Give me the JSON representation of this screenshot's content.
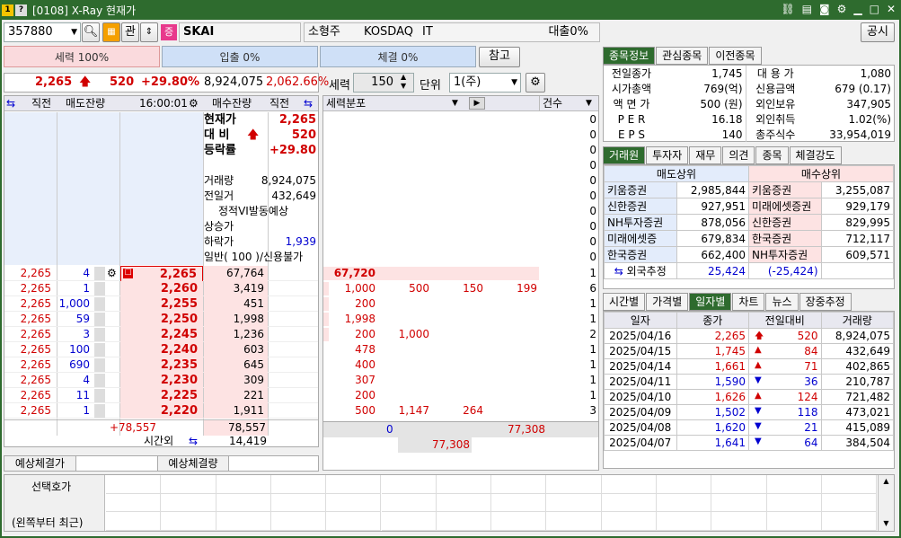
{
  "window": {
    "title": "[0108] X-Ray 현재가",
    "badge1": "1",
    "badge2": "?"
  },
  "toolbar": {
    "code": "357880",
    "btn_g": "관",
    "btn_jeung": "증",
    "name": "SKAI",
    "market_type": "소형주",
    "market": "KOSDAQ",
    "sector": "IT",
    "loan": "대출0%",
    "notice_btn": "공시"
  },
  "power": {
    "seryeok": "세력 100%",
    "ipchul": "입출 0%",
    "chegyeol": "체결 0%",
    "ref_btn": "참고"
  },
  "price_bar": {
    "price": "2,265",
    "change": "520",
    "rate": "+29.80%",
    "volume": "8,924,075",
    "vol_rate": "2,062.66%",
    "seryeok_label": "세력",
    "seryeok_val": "150",
    "unit_label": "단위",
    "unit_val": "1(주)"
  },
  "ob_header": {
    "h1": "직전",
    "h2": "매도잔량",
    "time": "16:00:01",
    "h4": "매수잔량",
    "h5": "직전"
  },
  "info": {
    "cur_label": "현재가",
    "cur_val": "2,265",
    "diff_label": "대 비",
    "diff_val": "520",
    "rate_label": "등락률",
    "rate_val": "+29.80",
    "vol_label": "거래량",
    "vol_val": "8,924,075",
    "prev_label": "전일거",
    "prev_val": "432,649",
    "vi": "정적VI발동예상",
    "upper": "상승가",
    "lower_label": "하락가",
    "lower_val": "1,939",
    "general": "일반( 100 )/신용불가"
  },
  "bids": [
    {
      "prev": "2,265",
      "qty": "4",
      "price": "2,265",
      "remain": "67,764"
    },
    {
      "prev": "2,265",
      "qty": "1",
      "price": "2,260",
      "remain": "3,419"
    },
    {
      "prev": "2,265",
      "qty": "1,000",
      "price": "2,255",
      "remain": "451"
    },
    {
      "prev": "2,265",
      "qty": "59",
      "price": "2,250",
      "remain": "1,998"
    },
    {
      "prev": "2,265",
      "qty": "3",
      "price": "2,245",
      "remain": "1,236"
    },
    {
      "prev": "2,265",
      "qty": "100",
      "price": "2,240",
      "remain": "603"
    },
    {
      "prev": "2,265",
      "qty": "690",
      "price": "2,235",
      "remain": "645"
    },
    {
      "prev": "2,265",
      "qty": "4",
      "price": "2,230",
      "remain": "309"
    },
    {
      "prev": "2,265",
      "qty": "11",
      "price": "2,225",
      "remain": "221"
    },
    {
      "prev": "2,265",
      "qty": "1",
      "price": "2,220",
      "remain": "1,911"
    }
  ],
  "ob_footer": {
    "diff": "+78,557",
    "total": "78,557",
    "after_label": "시간외",
    "after_val": "14,419"
  },
  "expect": {
    "label1": "예상체결가",
    "label2": "예상체결량"
  },
  "dist": {
    "header": "세력분포",
    "count_header": "건수",
    "rows": [
      {
        "c1": "67,720",
        "c2": "",
        "c3": "",
        "c4": "",
        "n": "1"
      },
      {
        "c1": "1,000",
        "c2": "500",
        "c3": "150",
        "c4": "199",
        "n": "6"
      },
      {
        "c1": "200",
        "c2": "",
        "c3": "",
        "c4": "",
        "n": "1"
      },
      {
        "c1": "1,998",
        "c2": "",
        "c3": "",
        "c4": "",
        "n": "1"
      },
      {
        "c1": "200",
        "c2": "1,000",
        "c3": "",
        "c4": "",
        "n": "2"
      },
      {
        "c1": "478",
        "c2": "",
        "c3": "",
        "c4": "",
        "n": "1"
      },
      {
        "c1": "400",
        "c2": "",
        "c3": "",
        "c4": "",
        "n": "1"
      },
      {
        "c1": "307",
        "c2": "",
        "c3": "",
        "c4": "",
        "n": "1"
      },
      {
        "c1": "200",
        "c2": "",
        "c3": "",
        "c4": "",
        "n": "1"
      },
      {
        "c1": "500",
        "c2": "1,147",
        "c3": "264",
        "c4": "",
        "n": "3"
      }
    ],
    "upper_counts": [
      "0",
      "0",
      "0",
      "0",
      "0",
      "0",
      "0",
      "0",
      "0",
      "0"
    ],
    "foot1": "0",
    "foot2": "77,308",
    "foot3": "77,308"
  },
  "rtabs": [
    "종목정보",
    "관심종목",
    "이전종목"
  ],
  "stock": [
    [
      "전일종가",
      "1,745",
      "대 용 가",
      "1,080"
    ],
    [
      "시가총액",
      "769(억)",
      "신용금액",
      "679  (0.17)"
    ],
    [
      "액 면 가",
      "500 (원)",
      "외인보유",
      "347,905"
    ],
    [
      "P E R",
      "16.18",
      "외인취득",
      "1.02(%)"
    ],
    [
      "E P S",
      "140",
      "총주식수",
      "33,954,019"
    ]
  ],
  "btabs": [
    "거래원",
    "투자자",
    "재무",
    "의견",
    "종목",
    "체결강도"
  ],
  "broker": {
    "sell_h": "매도상위",
    "buy_h": "매수상위",
    "rows": [
      [
        "키움증권",
        "2,985,844",
        "키움증권",
        "3,255,087"
      ],
      [
        "신한증권",
        "927,951",
        "미래에셋증권",
        "929,179"
      ],
      [
        "NH투자증권",
        "878,056",
        "신한증권",
        "829,995"
      ],
      [
        "미래에셋증",
        "679,834",
        "한국증권",
        "712,117"
      ],
      [
        "한국증권",
        "662,400",
        "NH투자증권",
        "609,571"
      ]
    ],
    "foreign_label": "외국추정",
    "foreign_sell": "25,424",
    "foreign_buy": "(-25,424)"
  },
  "dtabs": [
    "시간별",
    "가격별",
    "일자별",
    "차트",
    "뉴스",
    "장중추정"
  ],
  "daily": {
    "headers": [
      "일자",
      "종가",
      "전일대비",
      "거래량"
    ],
    "rows": [
      {
        "d": "2025/04/16",
        "p": "2,265",
        "dir": "up2",
        "c": "520",
        "v": "8,924,075"
      },
      {
        "d": "2025/04/15",
        "p": "1,745",
        "dir": "up",
        "c": "84",
        "v": "432,649"
      },
      {
        "d": "2025/04/14",
        "p": "1,661",
        "dir": "up",
        "c": "71",
        "v": "402,865"
      },
      {
        "d": "2025/04/11",
        "p": "1,590",
        "dir": "down",
        "c": "36",
        "v": "210,787"
      },
      {
        "d": "2025/04/10",
        "p": "1,626",
        "dir": "up",
        "c": "124",
        "v": "721,482"
      },
      {
        "d": "2025/04/09",
        "p": "1,502",
        "dir": "down",
        "c": "118",
        "v": "473,021"
      },
      {
        "d": "2025/04/08",
        "p": "1,620",
        "dir": "down",
        "c": "21",
        "v": "415,089"
      },
      {
        "d": "2025/04/07",
        "p": "1,641",
        "dir": "down",
        "c": "64",
        "v": "384,504"
      }
    ]
  },
  "select": {
    "label1": "선택호가",
    "label2": "(왼쪽부터 최근)"
  }
}
